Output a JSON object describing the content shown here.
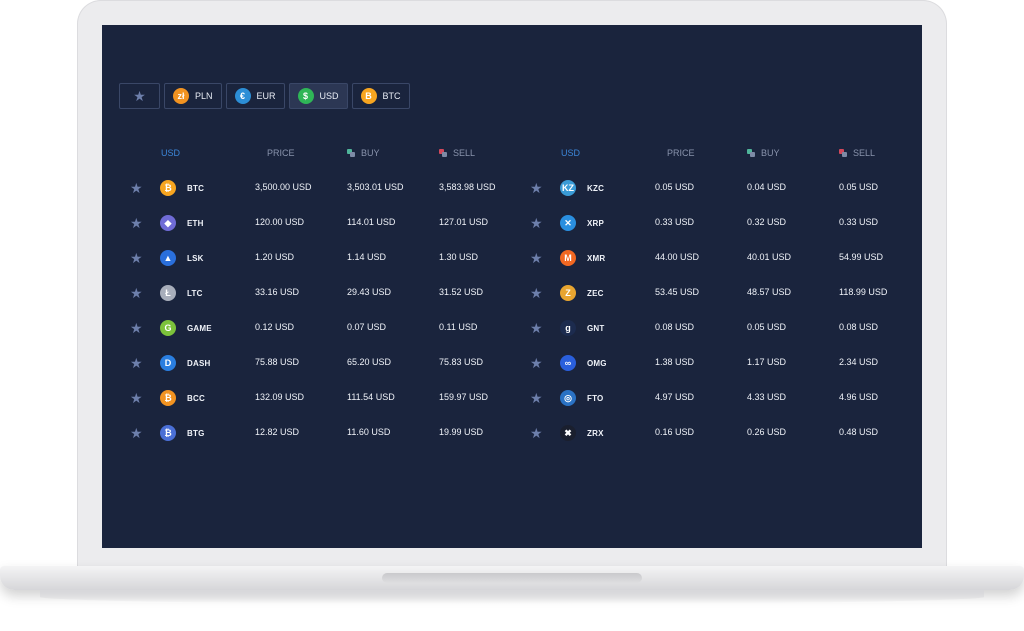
{
  "tabs": [
    {
      "label": "",
      "icon": "star-icon",
      "active": false
    },
    {
      "label": "PLN",
      "glyph": "zł",
      "color": "#f29321",
      "active": false
    },
    {
      "label": "EUR",
      "glyph": "€",
      "color": "#2c8ed6",
      "active": false
    },
    {
      "label": "USD",
      "glyph": "$",
      "color": "#2fb657",
      "active": true
    },
    {
      "label": "BTC",
      "glyph": "B",
      "color": "#f7a520",
      "active": false
    }
  ],
  "left_table": {
    "headers": {
      "currency": "USD",
      "price": "PRICE",
      "buy": "BUY",
      "sell": "SELL"
    },
    "rows": [
      {
        "symbol": "BTC",
        "glyph": "₿",
        "color": "#f7a520",
        "price": "3,500.00 USD",
        "buy": "3,503.01 USD",
        "sell": "3,583.98 USD"
      },
      {
        "symbol": "ETH",
        "glyph": "◆",
        "color": "#6f6bd6",
        "price": "120.00 USD",
        "buy": "114.01 USD",
        "sell": "127.01 USD"
      },
      {
        "symbol": "LSK",
        "glyph": "▲",
        "color": "#2a6fdc",
        "price": "1.20 USD",
        "buy": "1.14 USD",
        "sell": "1.30 USD"
      },
      {
        "symbol": "LTC",
        "glyph": "Ł",
        "color": "#a8aebb",
        "price": "33.16 USD",
        "buy": "29.43 USD",
        "sell": "31.52 USD"
      },
      {
        "symbol": "GAME",
        "glyph": "G",
        "color": "#7cc23b",
        "price": "0.12 USD",
        "buy": "0.07 USD",
        "sell": "0.11 USD"
      },
      {
        "symbol": "DASH",
        "glyph": "D",
        "color": "#2a7ee0",
        "price": "75.88 USD",
        "buy": "65.20 USD",
        "sell": "75.83 USD"
      },
      {
        "symbol": "BCC",
        "glyph": "₿",
        "color": "#f29321",
        "price": "132.09 USD",
        "buy": "111.54 USD",
        "sell": "159.97 USD"
      },
      {
        "symbol": "BTG",
        "glyph": "₿",
        "color": "#4a6fd6",
        "price": "12.82 USD",
        "buy": "11.60 USD",
        "sell": "19.99 USD"
      }
    ]
  },
  "right_table": {
    "headers": {
      "currency": "USD",
      "price": "PRICE",
      "buy": "BUY",
      "sell": "SELL"
    },
    "rows": [
      {
        "symbol": "KZC",
        "glyph": "KZ",
        "color": "#3a9bd6",
        "price": "0.05 USD",
        "buy": "0.04 USD",
        "sell": "0.05 USD"
      },
      {
        "symbol": "XRP",
        "glyph": "✕",
        "color": "#2a8fe0",
        "price": "0.33 USD",
        "buy": "0.32 USD",
        "sell": "0.33 USD"
      },
      {
        "symbol": "XMR",
        "glyph": "M",
        "color": "#f26822",
        "price": "44.00 USD",
        "buy": "40.01 USD",
        "sell": "54.99 USD"
      },
      {
        "symbol": "ZEC",
        "glyph": "Z",
        "color": "#e8a530",
        "price": "53.45 USD",
        "buy": "48.57 USD",
        "sell": "118.99 USD"
      },
      {
        "symbol": "GNT",
        "glyph": "g",
        "color": "#1c2b4e",
        "price": "0.08 USD",
        "buy": "0.05 USD",
        "sell": "0.08 USD"
      },
      {
        "symbol": "OMG",
        "glyph": "∞",
        "color": "#2a5fdc",
        "price": "1.38 USD",
        "buy": "1.17 USD",
        "sell": "2.34 USD"
      },
      {
        "symbol": "FTO",
        "glyph": "◎",
        "color": "#2a72c4",
        "price": "4.97 USD",
        "buy": "4.33 USD",
        "sell": "4.96 USD"
      },
      {
        "symbol": "ZRX",
        "glyph": "✖",
        "color": "#1a1f2e",
        "price": "0.16 USD",
        "buy": "0.26 USD",
        "sell": "0.48 USD"
      }
    ]
  }
}
